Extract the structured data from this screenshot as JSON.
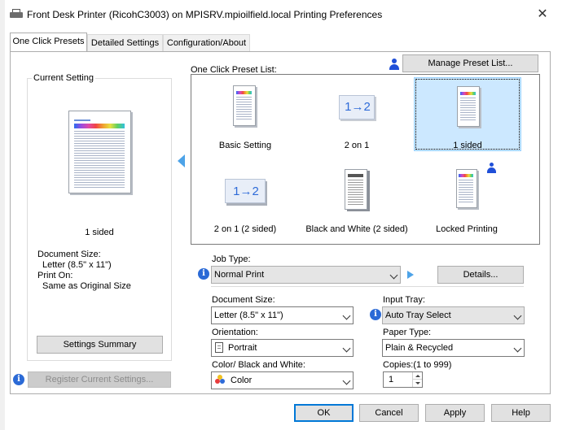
{
  "window": {
    "title": "Front Desk Printer (RicohC3003) on MPISRV.mpioilfield.local Printing Preferences"
  },
  "tabs": [
    {
      "label": "One Click Presets"
    },
    {
      "label": "Detailed Settings"
    },
    {
      "label": "Configuration/About"
    }
  ],
  "current_setting": {
    "heading": "Current Setting",
    "preview_label": "1 sided",
    "document_size_label": "Document Size:",
    "document_size_value": "Letter (8.5\" x 11\")",
    "print_on_label": "Print On:",
    "print_on_value": "Same as Original Size",
    "summary_button": "Settings Summary"
  },
  "register_button": "Register Current Settings...",
  "preset_list": {
    "label": "One Click Preset List:",
    "manage_button": "Manage Preset List...",
    "items": [
      {
        "label": "Basic Setting",
        "icon": "document-icon"
      },
      {
        "label": "2 on 1",
        "icon": "combine-icon",
        "glyph": "1→2"
      },
      {
        "label": "1 sided",
        "icon": "document-icon",
        "selected": true
      },
      {
        "label": "2 on 1 (2 sided)",
        "icon": "combine-duplex-icon",
        "glyph": "1→2"
      },
      {
        "label": "Black and White (2 sided)",
        "icon": "bw-duplex-icon"
      },
      {
        "label": "Locked Printing",
        "icon": "locked-print-icon"
      }
    ]
  },
  "job_type": {
    "label": "Job Type:",
    "value": "Normal Print",
    "details_button": "Details..."
  },
  "document_size": {
    "label": "Document Size:",
    "value": "Letter (8.5\" x 11\")"
  },
  "input_tray": {
    "label": "Input Tray:",
    "value": "Auto Tray Select"
  },
  "orientation": {
    "label": "Orientation:",
    "value": "Portrait"
  },
  "paper_type": {
    "label": "Paper Type:",
    "value": "Plain & Recycled"
  },
  "color_mode": {
    "label": "Color/ Black and White:",
    "value": "Color"
  },
  "copies": {
    "label": "Copies:(1 to 999)",
    "value": "1"
  },
  "buttons": {
    "ok": "OK",
    "cancel": "Cancel",
    "apply": "Apply",
    "help": "Help"
  },
  "colors": {
    "accent": "#0078d7",
    "selected_bg": "#cce8ff",
    "info": "#2b6ad6"
  }
}
